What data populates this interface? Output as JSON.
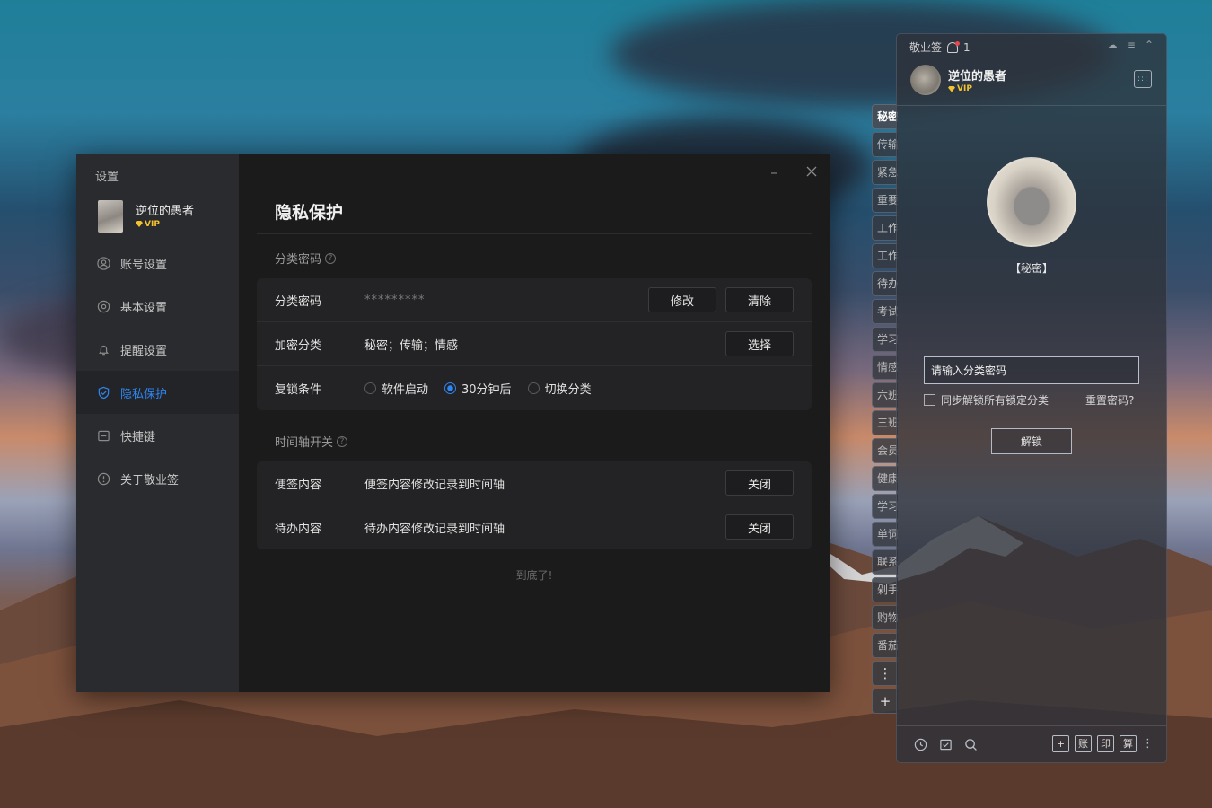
{
  "settings": {
    "window_title": "设置",
    "user": {
      "name": "逆位的愚者",
      "vip": "VIP"
    },
    "nav": [
      {
        "label": "账号设置",
        "icon": "user-circle-icon",
        "active": false
      },
      {
        "label": "基本设置",
        "icon": "gear-icon",
        "active": false
      },
      {
        "label": "提醒设置",
        "icon": "bell-icon",
        "active": false
      },
      {
        "label": "隐私保护",
        "icon": "shield-check-icon",
        "active": true
      },
      {
        "label": "快捷键",
        "icon": "keyboard-icon",
        "active": false
      },
      {
        "label": "关于敬业签",
        "icon": "info-icon",
        "active": false
      }
    ],
    "page_title": "隐私保护",
    "section_password": {
      "label": "分类密码",
      "rows": {
        "password": {
          "label": "分类密码",
          "value": "*********",
          "btn_modify": "修改",
          "btn_clear": "清除"
        },
        "encrypted": {
          "label": "加密分类",
          "value": "秘密；传输；情感",
          "btn_select": "选择"
        },
        "relock": {
          "label": "复锁条件",
          "options": [
            "软件启动",
            "30分钟后",
            "切换分类"
          ],
          "selected": "30分钟后"
        }
      }
    },
    "section_timeline": {
      "label": "时间轴开关",
      "rows": [
        {
          "label": "便签内容",
          "desc": "便签内容修改记录到时间轴",
          "btn": "关闭"
        },
        {
          "label": "待办内容",
          "desc": "待办内容修改记录到时间轴",
          "btn": "关闭"
        }
      ]
    },
    "end_text": "到底了!",
    "accent_color": "#2f86f0"
  },
  "notes_panel": {
    "app_name": "敬业签",
    "notify_count": "1",
    "user": {
      "name": "逆位的愚者",
      "vip": "VIP"
    },
    "category_label": "【秘密】",
    "password_placeholder": "请输入分类密码",
    "sync_label": "同步解锁所有锁定分类",
    "reset_label": "重置密码?",
    "unlock_label": "解锁",
    "tabs": [
      "秘密",
      "传输",
      "紧急",
      "重要",
      "工作",
      "工作",
      "待办",
      "考试",
      "学习",
      "情感",
      "六班",
      "三班",
      "会员",
      "健康",
      "学习",
      "单词",
      "联系",
      "剁手",
      "购物",
      "番茄"
    ],
    "footer_square_icons": [
      "+",
      "账",
      "印",
      "算"
    ]
  }
}
